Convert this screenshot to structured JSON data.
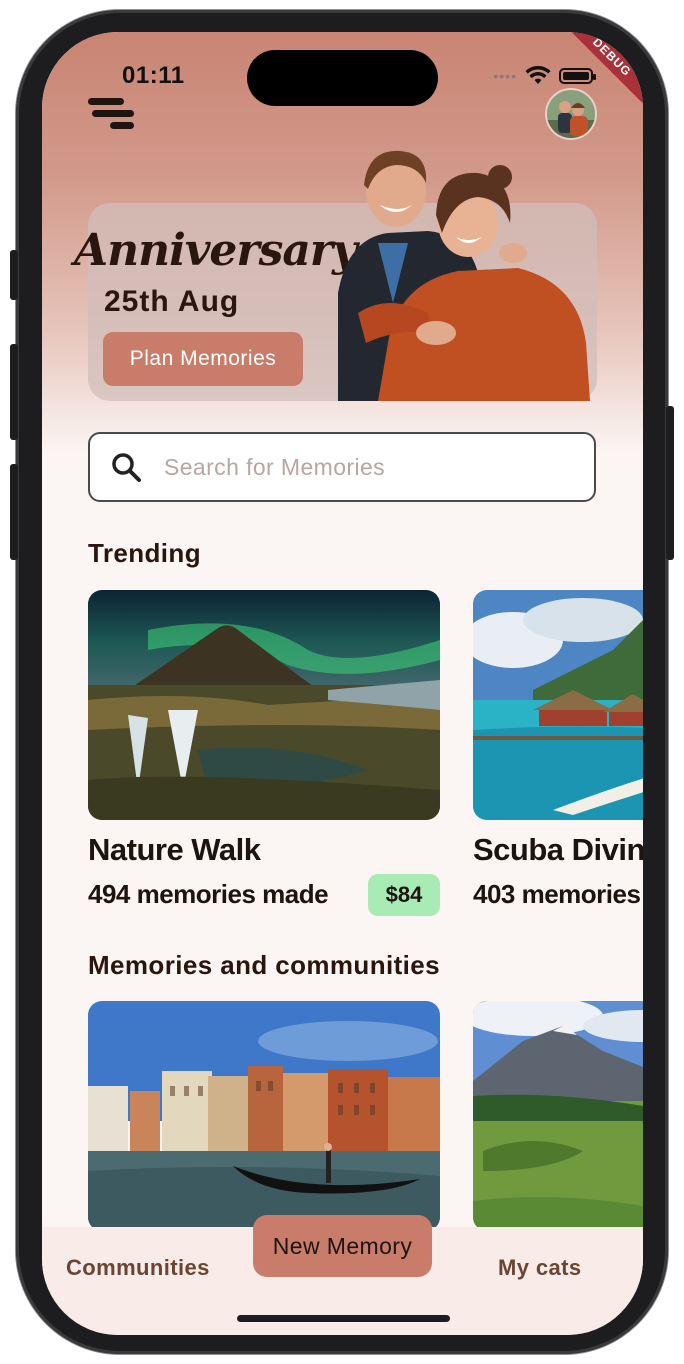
{
  "status_bar": {
    "time": "01:11",
    "debug_banner": "DEBUG"
  },
  "banner": {
    "title": "Anniversary",
    "date": "25th Aug",
    "button_label": "Plan Memories"
  },
  "search": {
    "placeholder": "Search for Memories"
  },
  "trending": {
    "title": "Trending",
    "cards": [
      {
        "name": "Nature Walk",
        "subtitle": "494 memories made",
        "price": "$84"
      },
      {
        "name": "Scuba Divin",
        "subtitle": "403 memories"
      }
    ]
  },
  "communities": {
    "title": "Memories and communities"
  },
  "bottom_nav": {
    "left_label": "Communities",
    "center_label": "New Memory",
    "right_label": "My cats"
  },
  "colors": {
    "accent": "#c97c6a",
    "price_badge": "#a8ebb4",
    "text_dark": "#2a160f",
    "nav_bg": "#f8ebe8"
  },
  "icons": [
    "menu-icon",
    "search-icon",
    "wifi-icon",
    "battery-icon",
    "signal-icon"
  ]
}
